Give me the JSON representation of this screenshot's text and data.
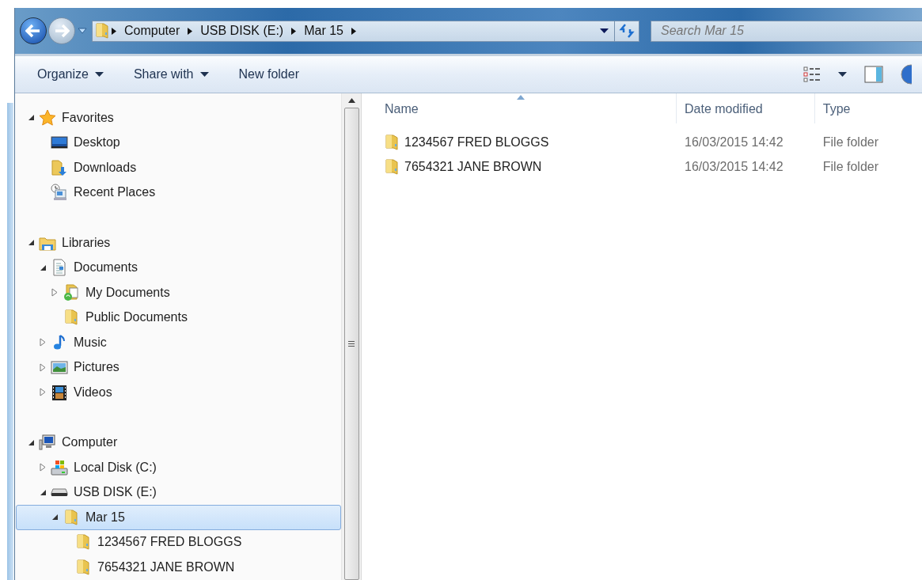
{
  "address_bar": {
    "crumbs": [
      "Computer",
      "USB DISK (E:)",
      "Mar 15"
    ],
    "search": {
      "placeholder": "Search Mar 15"
    }
  },
  "toolbar": {
    "buttons": [
      {
        "label": "Organize",
        "dropdown": true
      },
      {
        "label": "Share with",
        "dropdown": true
      },
      {
        "label": "New folder",
        "dropdown": false
      }
    ]
  },
  "navigation": {
    "groups": [
      {
        "label": "Favorites",
        "kind": "star",
        "expanded": true,
        "selected": false,
        "children": [
          {
            "label": "Desktop",
            "kind": "desktop",
            "selected": false
          },
          {
            "label": "Downloads",
            "kind": "downloads",
            "selected": false
          },
          {
            "label": "Recent Places",
            "kind": "recent",
            "selected": false
          }
        ]
      },
      {
        "label": "Libraries",
        "kind": "library",
        "expanded": true,
        "selected": false,
        "children": [
          {
            "label": "Documents",
            "kind": "document",
            "expanded": true,
            "selected": false,
            "children": [
              {
                "label": "My Documents",
                "kind": "mydocs",
                "expanded": false,
                "selected": false
              },
              {
                "label": "Public Documents",
                "kind": "folder",
                "selected": false
              }
            ]
          },
          {
            "label": "Music",
            "kind": "music",
            "expanded": false,
            "selected": false
          },
          {
            "label": "Pictures",
            "kind": "pictures",
            "expanded": false,
            "selected": false
          },
          {
            "label": "Videos",
            "kind": "videos",
            "expanded": false,
            "selected": false
          }
        ]
      },
      {
        "label": "Computer",
        "kind": "computer",
        "expanded": true,
        "selected": false,
        "children": [
          {
            "label": "Local Disk (C:)",
            "kind": "disk",
            "expanded": false,
            "selected": false
          },
          {
            "label": "USB DISK (E:)",
            "kind": "usb",
            "expanded": true,
            "selected": false,
            "children": [
              {
                "label": "Mar 15",
                "kind": "folder",
                "expanded": true,
                "selected": true,
                "children": [
                  {
                    "label": "1234567 FRED BLOGGS",
                    "kind": "folder",
                    "selected": false
                  },
                  {
                    "label": "7654321 JANE BROWN",
                    "kind": "folder",
                    "selected": false
                  }
                ]
              }
            ]
          }
        ]
      }
    ]
  },
  "file_list": {
    "columns": [
      {
        "label": "Name",
        "sorted": true
      },
      {
        "label": "Date modified",
        "sorted": false
      },
      {
        "label": "Type",
        "sorted": false
      }
    ],
    "rows": [
      {
        "name": "1234567 FRED BLOGGS",
        "date_modified": "16/03/2015 14:42",
        "type": "File folder"
      },
      {
        "name": "7654321 JANE BROWN",
        "date_modified": "16/03/2015 14:42",
        "type": "File folder"
      }
    ]
  }
}
